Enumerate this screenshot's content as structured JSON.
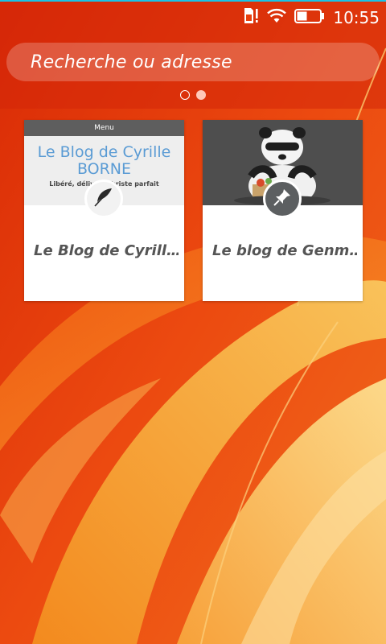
{
  "status_bar": {
    "time": "10:55",
    "icons": [
      "sim-alert-icon",
      "wifi-icon",
      "battery-icon"
    ],
    "accent_color": "#19c3e6"
  },
  "search": {
    "placeholder": "Recherche ou adresse"
  },
  "pager": {
    "pages": 2,
    "current_page": 2
  },
  "tiles": [
    {
      "thumbnail": {
        "menu_label": "Menu",
        "title": "Le Blog de Cyrille BORNE",
        "title_line1": "Le Blog de Cyrille",
        "title_line2": "BORNE",
        "tagline": "Libéré, délivré, libriste parfait"
      },
      "badge_icon": "feather-icon",
      "label": "Le Blog de Cyrill…"
    },
    {
      "thumbnail": {
        "image": "panda-illustration"
      },
      "badge_icon": "pin-icon",
      "label": "Le blog de Genm…"
    }
  ],
  "colors": {
    "wallpaper_primary": "#e8400e",
    "wallpaper_highlight": "#f6b24a",
    "tile_label": "#555555",
    "blog_title": "#5a9bd4"
  }
}
